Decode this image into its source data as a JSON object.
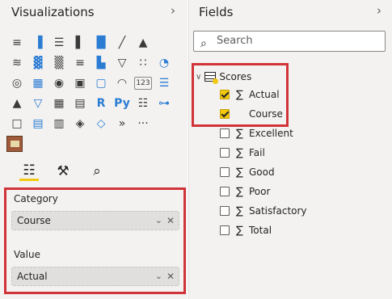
{
  "visualizations": {
    "title": "Visualizations",
    "collapse_icon": "chevron-right-icon",
    "icon_rows": [
      [
        {
          "name": "stacked-bar-chart-icon",
          "glyph": "≡"
        },
        {
          "name": "stacked-column-chart-icon",
          "glyph": "▐"
        },
        {
          "name": "clustered-bar-chart-icon",
          "glyph": "☰"
        },
        {
          "name": "clustered-column-chart-icon",
          "glyph": "▌"
        },
        {
          "name": "100-column-chart-icon",
          "glyph": "█"
        },
        {
          "name": "line-chart-icon",
          "glyph": "╱"
        },
        {
          "name": "area-chart-icon",
          "glyph": "▲"
        }
      ],
      [
        {
          "name": "stacked-area-chart-icon",
          "glyph": "≋"
        },
        {
          "name": "line-and-column-chart-icon",
          "glyph": "▓"
        },
        {
          "name": "line-and-clustered-column-icon",
          "glyph": "▒"
        },
        {
          "name": "ribbon-chart-icon",
          "glyph": "≡"
        },
        {
          "name": "waterfall-chart-icon",
          "glyph": "▙"
        },
        {
          "name": "funnel-chart-icon",
          "glyph": "▽"
        },
        {
          "name": "scatter-chart-icon",
          "glyph": "∷"
        },
        {
          "name": "pie-chart-icon",
          "glyph": "◔"
        }
      ],
      [
        {
          "name": "donut-chart-icon",
          "glyph": "◎"
        },
        {
          "name": "treemap-icon",
          "glyph": "▦"
        },
        {
          "name": "map-icon",
          "glyph": "◉"
        },
        {
          "name": "filled-map-icon",
          "glyph": "▣"
        },
        {
          "name": "shape-map-icon",
          "glyph": "▢"
        },
        {
          "name": "gauge-icon",
          "glyph": "◠"
        },
        {
          "name": "card-icon",
          "glyph": "123"
        },
        {
          "name": "multi-row-card-icon",
          "glyph": "☰"
        }
      ],
      [
        {
          "name": "kpi-icon",
          "glyph": "▲"
        },
        {
          "name": "slicer-icon",
          "glyph": "▽"
        },
        {
          "name": "table-icon",
          "glyph": "▦"
        },
        {
          "name": "matrix-icon",
          "glyph": "▤"
        },
        {
          "name": "r-script-visual-icon",
          "glyph": "R"
        },
        {
          "name": "python-visual-icon",
          "glyph": "Py"
        },
        {
          "name": "key-influencers-icon",
          "glyph": "☷"
        },
        {
          "name": "decomposition-tree-icon",
          "glyph": "⊶"
        }
      ],
      [
        {
          "name": "qna-icon",
          "glyph": "□"
        },
        {
          "name": "paginated-report-icon",
          "glyph": "▤"
        },
        {
          "name": "smart-narrative-icon",
          "glyph": "▥"
        },
        {
          "name": "metrics-icon",
          "glyph": "◈"
        },
        {
          "name": "power-apps-icon",
          "glyph": "◇"
        },
        {
          "name": "power-automate-icon",
          "glyph": "»"
        },
        {
          "name": "more-visuals-icon",
          "glyph": "···"
        }
      ]
    ],
    "custom_visual_icon": "custom-visual-icon",
    "tool_tabs": [
      {
        "name": "build-visual-tab-icon",
        "glyph": "☷",
        "active": true
      },
      {
        "name": "format-paint-roller-icon",
        "glyph": "⚒",
        "active": false
      },
      {
        "name": "analytics-magnifier-icon",
        "glyph": "⌕",
        "active": false
      }
    ],
    "wells": {
      "category_label": "Category",
      "category_value": "Course",
      "value_label": "Value",
      "value_value": "Actual"
    }
  },
  "fields": {
    "title": "Fields",
    "collapse_icon": "chevron-right-icon",
    "search_placeholder": "Search",
    "table_name": "Scores",
    "items": [
      {
        "label": "Actual",
        "checked": true,
        "aggregate": true
      },
      {
        "label": "Course",
        "checked": true,
        "aggregate": false
      },
      {
        "label": "Excellent",
        "checked": false,
        "aggregate": true
      },
      {
        "label": "Fail",
        "checked": false,
        "aggregate": true
      },
      {
        "label": "Good",
        "checked": false,
        "aggregate": true
      },
      {
        "label": "Poor",
        "checked": false,
        "aggregate": true
      },
      {
        "label": "Satisfactory",
        "checked": false,
        "aggregate": true
      },
      {
        "label": "Total",
        "checked": false,
        "aggregate": true
      }
    ]
  },
  "colors": {
    "highlight_border": "#d13438",
    "check_yellow": "#f2c811",
    "pane_bg": "#f3f2f1"
  }
}
